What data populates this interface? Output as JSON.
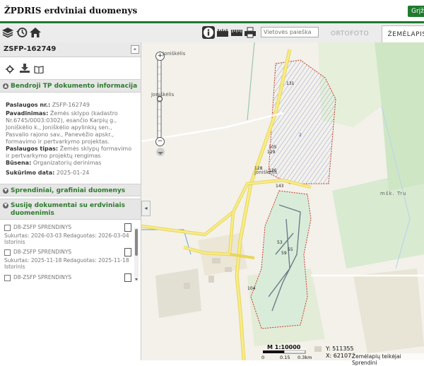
{
  "app": {
    "title": "ŽPDRIS erdviniai duomenys",
    "return_label": "Grįž"
  },
  "toolbar": {
    "left_icons": [
      "layers-icon",
      "history-icon",
      "home-icon"
    ],
    "tool_icons": [
      "info-icon",
      "measure-icon",
      "ruler-icon",
      "print-icon"
    ],
    "search_placeholder": "Vietovės paieška",
    "tabs": [
      {
        "label": "ORTOFOTO",
        "active": false
      },
      {
        "label": "ŽEMĖLAPIS",
        "active": true
      }
    ]
  },
  "panel": {
    "id": "ZSFP-162749",
    "collapse_label": "«",
    "action_icons": [
      "target-icon",
      "download-icon",
      "book-icon"
    ],
    "section1": {
      "title": "Bendroji TP dokumento informacija",
      "rows": [
        {
          "label": "Paslaugos nr.:",
          "value": "ZSFP-162749"
        },
        {
          "label": "Pavadinimas:",
          "value": "Žemės sklypo (kadastro Nr.6745/0003:0302), esančio Karpių g., Joniškėlio k., Joniškėlio apylinkių sen., Pasvalio rajono sav., Panevėžio apskr., formavimo ir pertvarkymo projektas."
        },
        {
          "label": "Paslaugos tipas:",
          "value": "Žemės sklypų formavimo ir pertvarkymo projektų rengimas"
        },
        {
          "label": "Būsena:",
          "value": "Organizatorių derinimas"
        },
        {
          "label": "Sukūrimo data:",
          "value": "2025-01-24"
        }
      ]
    },
    "section2": {
      "title": "Sprendiniai, grafiniai duomenys"
    },
    "section3": {
      "title": "Susiję dokumentai su erdviniais duomenimis",
      "docs": [
        {
          "name": "D8-ZSFP SPRENDINYS",
          "meta": "Sukurtas: 2026-03-03 Redaguotas: 2026-03-04 Istorinis"
        },
        {
          "name": "D8-ZSFP SPRENDINYS",
          "meta": "Sukurtas: 2025-11-18 Redaguotas: 2025-11-18 Istorinis"
        },
        {
          "name": "D8-ZSFP SPRENDINYS",
          "meta": ""
        }
      ]
    }
  },
  "map": {
    "place_labels": [
      "Joniškėlis",
      "Joniškėlis",
      "Joniškėlis",
      "mšk. Tru"
    ],
    "parcel_numbers": [
      "131",
      "105",
      "126",
      "129",
      "53",
      "55",
      "59",
      "104",
      "143",
      "128",
      "2"
    ],
    "scale_label": "M 1:10000",
    "scale_ticks": [
      "0",
      "0.15",
      "0.3km"
    ],
    "coordinates": {
      "y": "Y: 511355",
      "x": "X: 621072"
    },
    "credit": "Žemėlapių teikėjai Sprendini",
    "zoom_in": "+",
    "zoom_out": "−",
    "pan_label": "◂"
  },
  "colors": {
    "brand_green": "#1f7a2e",
    "road_yellow": "#f2e14a",
    "parcel_outline": "#c0392b",
    "hatch_blue": "#7b8fd6"
  }
}
